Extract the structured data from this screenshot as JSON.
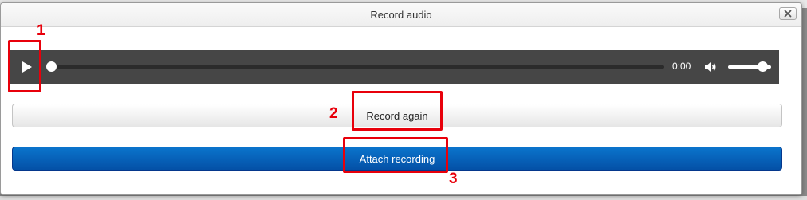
{
  "dialog": {
    "title": "Record audio",
    "close_icon": "close-x-icon"
  },
  "player": {
    "play_icon": "play-icon",
    "time": "0:00",
    "volume_icon": "volume-icon",
    "progress": 0,
    "volume_level": 0.8
  },
  "buttons": {
    "record_again_label": "Record again",
    "attach_label": "Attach recording"
  },
  "callouts": [
    {
      "number": "1"
    },
    {
      "number": "2"
    },
    {
      "number": "3"
    }
  ],
  "colors": {
    "callout_red": "#e8000b",
    "attach_blue": "#0561b8",
    "player_bg": "#464646"
  }
}
